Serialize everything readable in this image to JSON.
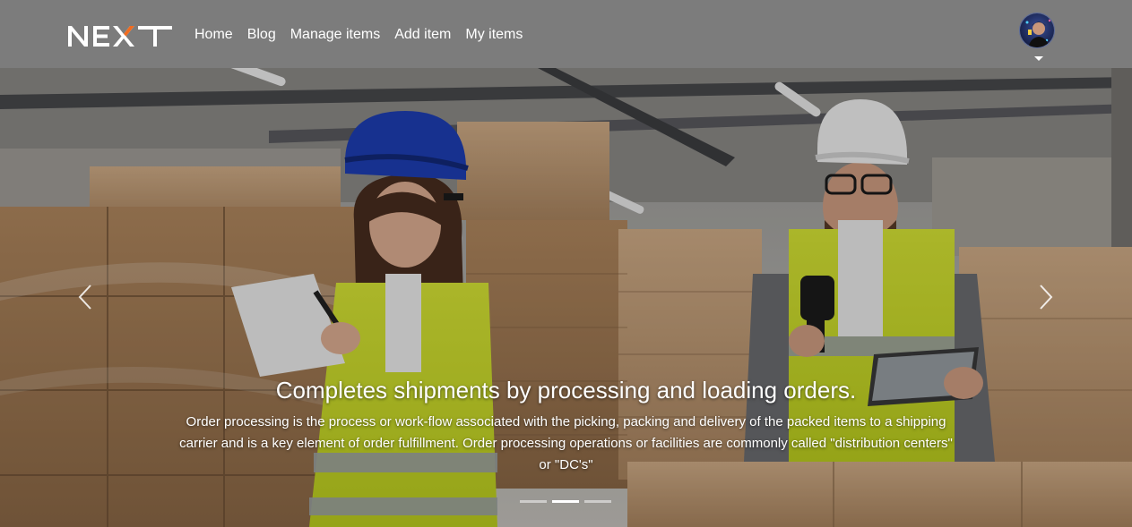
{
  "navbar": {
    "brand": "NEXT",
    "links": [
      "Home",
      "Blog",
      "Manage items",
      "Add item",
      "My items"
    ],
    "avatar_icon": "user-avatar-icon",
    "background": "#7c7c7c"
  },
  "carousel": {
    "slide_count": 3,
    "active_index": 1,
    "caption_title": "Completes shipments by processing and loading orders.",
    "caption_text": "Order processing is the process or work-flow associated with the picking, packing and delivery of the packed items to a shipping carrier and is a key element of order fulfillment. Order processing operations or facilities are commonly called \"distribution centers\" or \"DC's\"",
    "prev_icon": "chevron-left-icon",
    "next_icon": "chevron-right-icon"
  },
  "colors": {
    "safety_vest": "#d7e82c",
    "helmet_blue": "#1e3fb8",
    "cardboard": "#b98d62"
  }
}
